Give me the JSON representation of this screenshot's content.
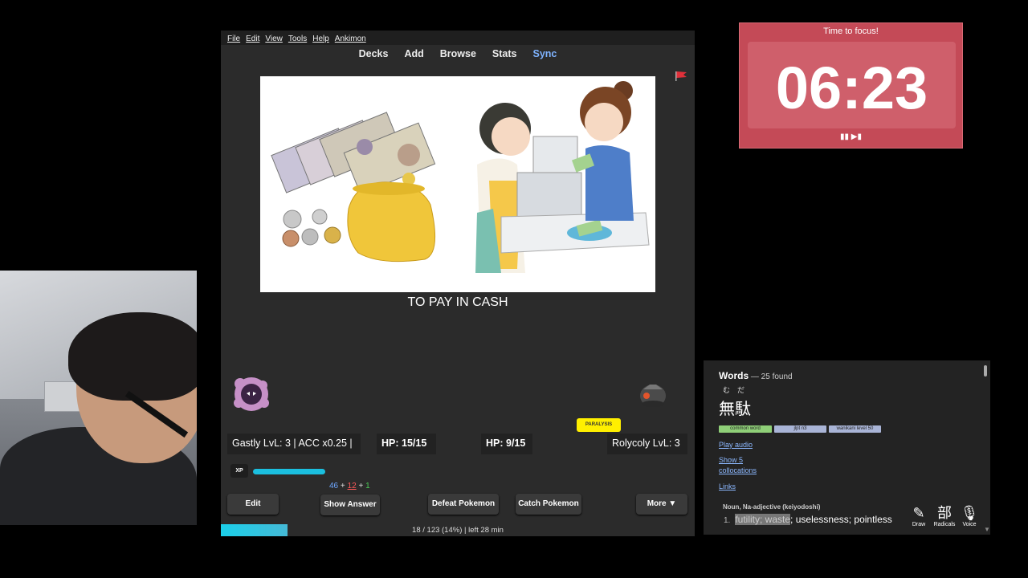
{
  "menu": [
    "File",
    "Edit",
    "View",
    "Tools",
    "Help",
    "Ankimon"
  ],
  "toolbar": [
    "Decks",
    "Add",
    "Browse",
    "Stats",
    "Sync"
  ],
  "card": {
    "text": "TO PAY IN CASH"
  },
  "battle": {
    "status": "PARALYSIS",
    "player": "Gastly LvL: 3 | ACC x0.25 |",
    "player_hp": "HP: 15/15",
    "enemy_hp": "HP: 9/15",
    "enemy": "Rolycoly LvL: 3",
    "xp_label": "XP",
    "xp_fill": 0.35
  },
  "counts": {
    "new": "46",
    "learn": "12",
    "review": "1",
    "plus": "+"
  },
  "buttons": {
    "edit": "Edit",
    "show_answer": "Show Answer",
    "defeat": "Defeat Pokemon",
    "catch": "Catch Pokemon",
    "more": "More ▼"
  },
  "progress": {
    "text": "18 / 123 (14%) | left 28 min",
    "fraction": 0.14
  },
  "timer": {
    "title": "Time to focus!",
    "value": "06:23",
    "controls": "▮▮ ▶▮"
  },
  "dictionary": {
    "title": "Words",
    "count": " — 25 found",
    "furigana": "むだ",
    "word": "無駄",
    "tags": [
      "common word",
      "jlpt n3",
      "wanikani level 50"
    ],
    "play_audio": "Play audio",
    "collocations_1": "Show 5",
    "collocations_2": "collocations",
    "links": "Links",
    "pos": "Noun, Na-adjective (keiyodoshi)",
    "def_num": "1.",
    "def_hl": "futility; waste",
    "def_rest": "; uselessness; pointless",
    "tools": [
      "Draw",
      "Radicals",
      "Voice"
    ],
    "tool_icons": [
      "✎",
      "部",
      "🎙"
    ]
  },
  "colors": {
    "sync": "#7fb3ff",
    "timer_bg": "#c44a57",
    "status_badge": "#ffef00",
    "xp": "#1bbfdf"
  }
}
